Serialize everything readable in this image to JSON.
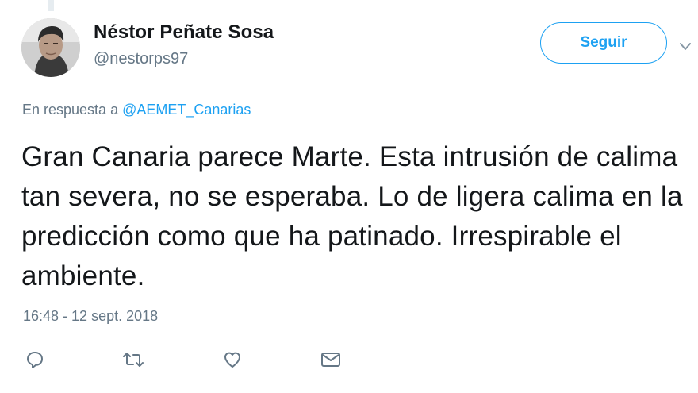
{
  "tweet": {
    "author": {
      "display_name": "Néstor Peñate Sosa",
      "handle": "@nestorps97"
    },
    "follow_button_label": "Seguir",
    "reply_context": {
      "prefix": "En respuesta a",
      "target": "@AEMET_Canarias"
    },
    "text": "Gran Canaria parece Marte. Esta intrusión de calima tan severa, no se esperaba. Lo de ligera calima en la predicción como que ha patinado. Irrespirable el ambiente.",
    "timestamp": "16:48 - 12 sept. 2018"
  },
  "actions": [
    {
      "name": "reply",
      "icon": "reply-icon"
    },
    {
      "name": "retweet",
      "icon": "retweet-icon"
    },
    {
      "name": "like",
      "icon": "heart-icon"
    },
    {
      "name": "direct-message",
      "icon": "envelope-icon"
    }
  ],
  "colors": {
    "accent": "#1da1f2",
    "text": "#14171a",
    "secondary": "#657786",
    "icon": "#657786"
  }
}
